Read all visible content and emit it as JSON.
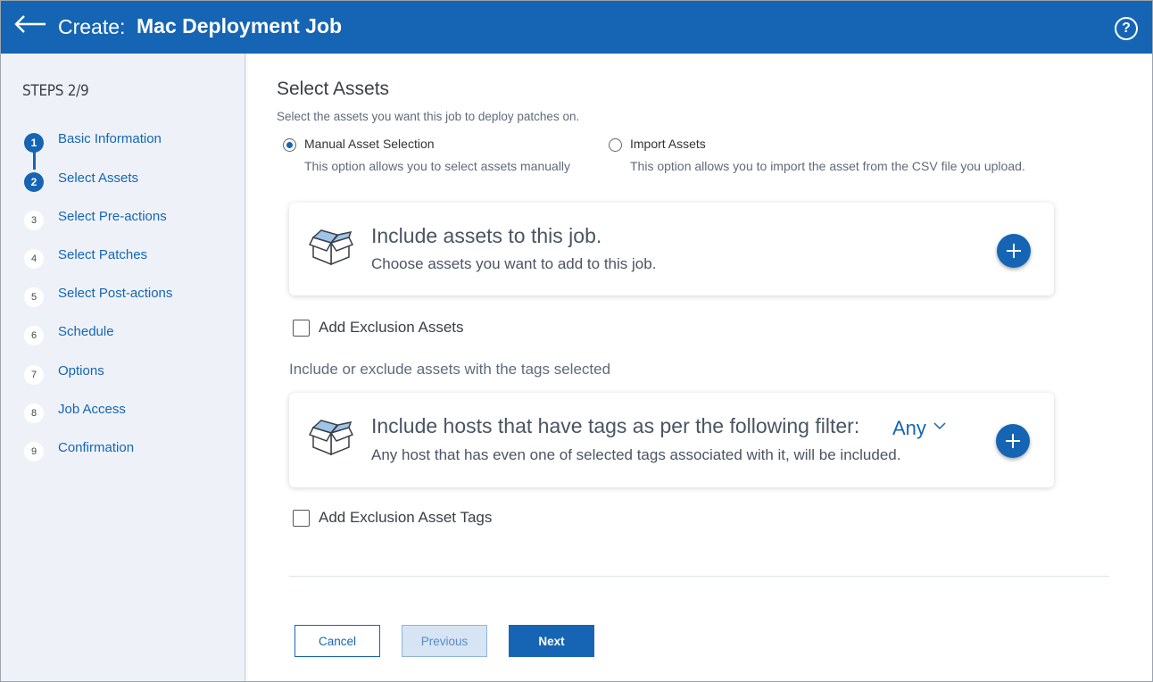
{
  "header": {
    "title_prefix": "Create:",
    "title_name": "Mac Deployment Job",
    "help_glyph": "?",
    "bg_color": "#1565b4"
  },
  "sidebar": {
    "steps_title": "STEPS 2/9",
    "current_step": 2,
    "steps": [
      {
        "num": "1",
        "label": "Basic Information",
        "state": "completed"
      },
      {
        "num": "2",
        "label": "Select Assets",
        "state": "active"
      },
      {
        "num": "3",
        "label": "Select Pre-actions",
        "state": "pending"
      },
      {
        "num": "4",
        "label": "Select Patches",
        "state": "pending"
      },
      {
        "num": "5",
        "label": "Select Post-actions",
        "state": "pending"
      },
      {
        "num": "6",
        "label": "Schedule",
        "state": "pending"
      },
      {
        "num": "7",
        "label": "Options",
        "state": "pending"
      },
      {
        "num": "8",
        "label": "Job Access",
        "state": "pending"
      },
      {
        "num": "9",
        "label": "Confirmation",
        "state": "pending"
      }
    ]
  },
  "main": {
    "section_title": "Select Assets",
    "section_desc": "Select the assets you want this job to deploy patches on.",
    "options": [
      {
        "label": "Manual Asset Selection",
        "desc": "This option allows you to select assets manually",
        "selected": true
      },
      {
        "label": "Import Assets",
        "desc": "This option allows you to import the asset from the CSV file you upload.",
        "selected": false
      }
    ],
    "include_card": {
      "icon": "open-box-icon",
      "title": "Include assets to this job.",
      "subtitle": "Choose assets you want to add to this job."
    },
    "exclusion_assets_label": "Add Exclusion Assets",
    "exclusion_assets_checked": false,
    "tags_note": "Include or exclude assets with the tags selected",
    "tags_card": {
      "icon": "open-box-icon",
      "title": "Include hosts that have tags as per the following filter:",
      "filter_value": "Any",
      "subtitle": "Any host that has even one of selected tags associated with it, will be included."
    },
    "exclusion_tags_label": "Add Exclusion Asset Tags",
    "exclusion_tags_checked": false
  },
  "footer": {
    "cancel_label": "Cancel",
    "previous_label": "Previous",
    "next_label": "Next"
  }
}
